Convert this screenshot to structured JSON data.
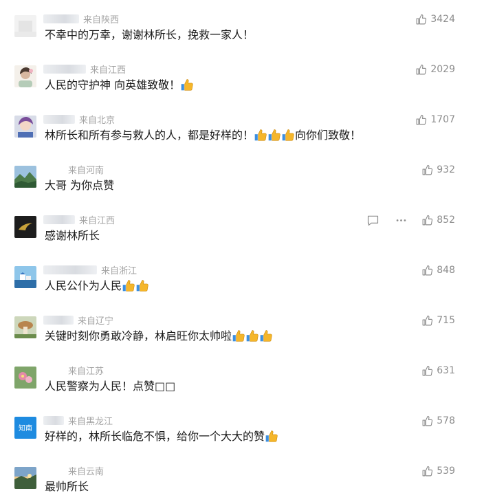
{
  "comments": [
    {
      "location": "来自陕西",
      "text": "不幸中的万幸，谢谢林所长，挽救一家人！",
      "thumbs": 0,
      "suffix": "",
      "likes": "3424",
      "avatar": "blurred-avatar"
    },
    {
      "location": "来自江西",
      "text": "人民的守护神 向英雄致敬！",
      "thumbs": 1,
      "suffix": "",
      "likes": "2029",
      "avatar": "portrait-avatar"
    },
    {
      "location": "来自北京",
      "text": "林所长和所有参与救人的人，都是好样的！",
      "thumbs": 3,
      "suffix": "向你们致敬！",
      "likes": "1707",
      "avatar": "anime-avatar"
    },
    {
      "location": "来自河南",
      "text": "大哥  为你点赞",
      "thumbs": 0,
      "suffix": "",
      "likes": "932",
      "avatar": "landscape-avatar"
    },
    {
      "location": "来自江西",
      "text": "感谢林所长",
      "thumbs": 0,
      "suffix": "",
      "likes": "852",
      "avatar": "dark-logo-avatar"
    },
    {
      "location": "来自浙江",
      "text": "人民公仆为人民",
      "thumbs": 2,
      "suffix": "",
      "likes": "848",
      "avatar": "coastal-town-avatar"
    },
    {
      "location": "来自辽宁",
      "text": "关键时刻你勇敢冷静，林启旺你太帅啦",
      "thumbs": 3,
      "suffix": "",
      "likes": "715",
      "avatar": "mushroom-avatar"
    },
    {
      "location": "来自江苏",
      "text": "人民警察为人民！点赞",
      "thumbs": 0,
      "suffix": "□□",
      "likes": "631",
      "avatar": "flower-avatar"
    },
    {
      "location": "来自黑龙江",
      "text": "好样的，林所长临危不惧，给你一个大大的赞",
      "thumbs": 1,
      "suffix": "",
      "likes": "578",
      "avatar": "blue-logo-avatar",
      "avatar_text": "知南"
    },
    {
      "location": "来自云南",
      "text": "最帅所长",
      "thumbs": 0,
      "suffix": "",
      "likes": "539",
      "avatar": "sunset-avatar"
    }
  ],
  "colors": {
    "meta": "#9a9a9a",
    "text": "#1a1a1a",
    "like": "#8d8d8d",
    "thumb_emoji": "#f5b62a"
  },
  "icons": {
    "like": "thumbs-up-icon",
    "reply": "comment-icon",
    "more": "more-icon",
    "emoji": "thumbs-up-emoji"
  }
}
